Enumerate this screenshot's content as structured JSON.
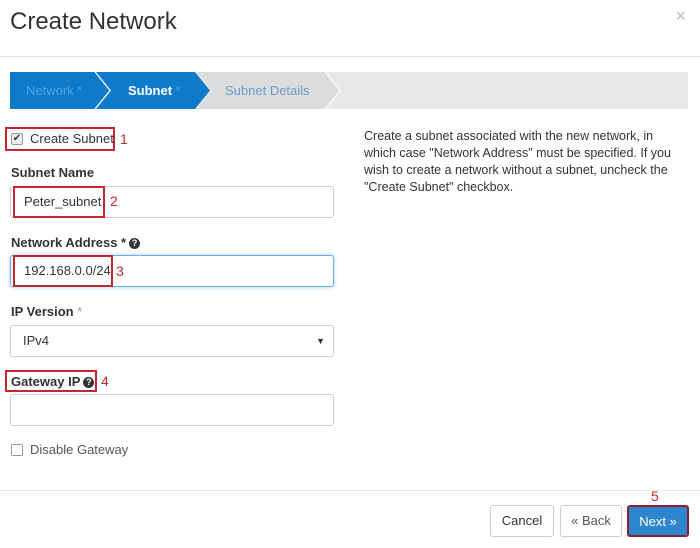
{
  "modal": {
    "title": "Create Network",
    "close": "×"
  },
  "wizard": {
    "steps": [
      {
        "label": "Network",
        "req": " *"
      },
      {
        "label": "Subnet",
        "req": " *"
      },
      {
        "label": "Subnet Details",
        "req": ""
      }
    ]
  },
  "form": {
    "create_subnet": {
      "label": "Create Subnet",
      "checked": true
    },
    "subnet_name": {
      "label": "Subnet Name",
      "value": "Peter_subnet"
    },
    "network_address": {
      "label": "Network Address",
      "req": " *",
      "value": "192.168.0.0/24"
    },
    "ip_version": {
      "label": "IP Version",
      "req": " *",
      "value": "IPv4"
    },
    "gateway_ip": {
      "label": "Gateway IP",
      "value": ""
    },
    "disable_gateway": {
      "label": "Disable Gateway",
      "checked": false
    }
  },
  "help_text": "Create a subnet associated with the new network, in which case \"Network Address\" must be specified. If you wish to create a network without a subnet, uncheck the \"Create Subnet\" checkbox.",
  "annotations": [
    "1",
    "2",
    "3",
    "4",
    "5"
  ],
  "footer": {
    "cancel": "Cancel",
    "back": "« Back",
    "next": "Next »"
  },
  "colors": {
    "primary": "#0d7bc9",
    "annotation": "#c0282d"
  }
}
